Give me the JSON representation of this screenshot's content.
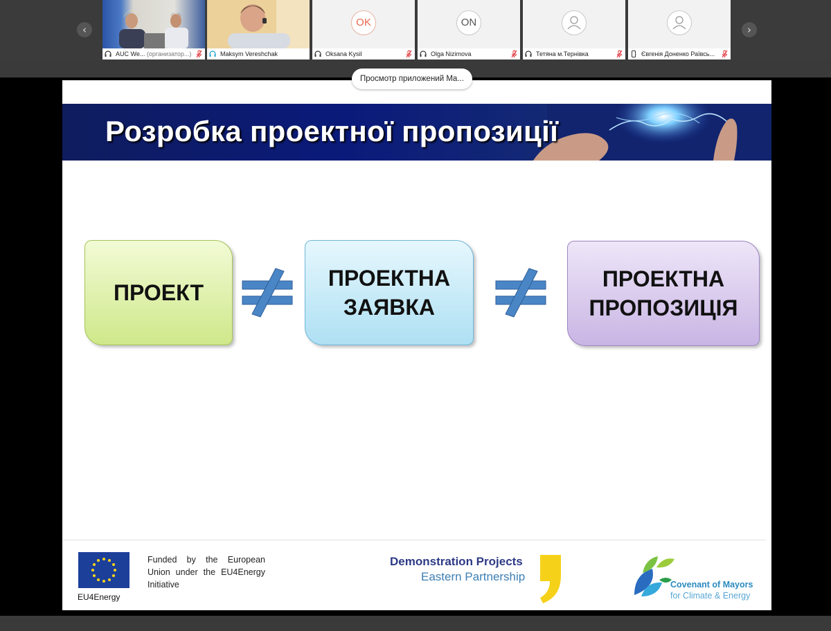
{
  "participants": [
    {
      "name": "AUC We...",
      "suffix": "(организатор...)",
      "device": "headset",
      "muted": true
    },
    {
      "name": "Maksym Vereshchak",
      "suffix": "",
      "device": "headset",
      "muted": false,
      "active": true
    },
    {
      "name": "Oksana Kysil",
      "suffix": "",
      "device": "headset",
      "muted": true,
      "badge": "OK"
    },
    {
      "name": "Olga Nizimova",
      "suffix": "",
      "device": "headset",
      "muted": true,
      "badge": "ON"
    },
    {
      "name": "Тетяна м.Тернівка",
      "suffix": "",
      "device": "headset",
      "muted": true
    },
    {
      "name": "Євгенія Доненко Раївсь...",
      "suffix": "",
      "device": "phone",
      "muted": true
    }
  ],
  "tooltip": "Просмотр приложений Ma...",
  "slide": {
    "title": "Розробка проектної пропозиції",
    "boxes": [
      {
        "line1": "ПРОЕКТ",
        "line2": ""
      },
      {
        "line1": "ПРОЕКТНА",
        "line2": "ЗАЯВКА"
      },
      {
        "line1": "ПРОЕКТНА",
        "line2": "ПРОПОЗИЦІЯ"
      }
    ],
    "operator_icon": "not-equal-icon",
    "footer": {
      "eu_caption": "EU4Energy",
      "funded_text": "Funded by the European Union under the EU4Energy Initiative",
      "demo_line1": "Demonstration Projects",
      "demo_line2": "Eastern Partnership",
      "com_line1": "Covenant of Mayors",
      "com_line2": "for Climate & Energy"
    }
  },
  "colors": {
    "accent": "#23b6e6",
    "banner": "#0a1a7a",
    "box1": "#cfe88a",
    "box2": "#aee0f3",
    "box3": "#c9b5e4",
    "neq": "#4a86c6"
  }
}
